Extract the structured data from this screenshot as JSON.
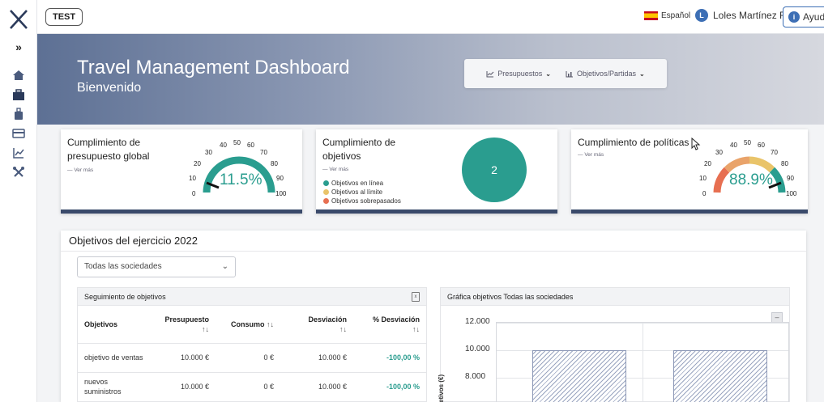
{
  "env": "TEST",
  "topbar": {
    "language": "Español",
    "user_initial": "L",
    "user_name": "Loles Martínez Roca",
    "help": "Ayuda"
  },
  "sidebar": {
    "expand": "»"
  },
  "hero": {
    "title": "Travel Management Dashboard",
    "subtitle": "Bienvenido",
    "menu": [
      {
        "label": "Presupuestos"
      },
      {
        "label": "Objetivos/Partidas"
      }
    ]
  },
  "cards": {
    "budget": {
      "title_1": "Cumplimiento de",
      "title_2": "presupuesto global",
      "more": "Ver más",
      "value": "11.5%",
      "ticks": [
        "0",
        "10",
        "20",
        "30",
        "40",
        "50",
        "60",
        "70",
        "80",
        "90",
        "100"
      ]
    },
    "goals": {
      "title_1": "Cumplimiento de",
      "title_2": "objetivos",
      "more": "Ver más",
      "count": "2",
      "legend": [
        {
          "label": "Objetivos en línea",
          "color": "#2a9d8f"
        },
        {
          "label": "Objetivos al límite",
          "color": "#e9c46a"
        },
        {
          "label": "Objetivos sobrepasados",
          "color": "#e76f51"
        }
      ]
    },
    "policies": {
      "title": "Cumplimiento de políticas",
      "more": "Ver más",
      "value": "88.9%",
      "ticks": [
        "0",
        "10",
        "20",
        "30",
        "40",
        "50",
        "60",
        "70",
        "80",
        "90",
        "100"
      ]
    }
  },
  "objectives": {
    "title": "Objetivos del ejercicio 2022",
    "company_select": "Todas las sociedades",
    "table": {
      "title": "Seguimiento de objetivos",
      "headers": {
        "objective": "Objetivos",
        "budget": "Presupuesto",
        "consumption": "Consumo",
        "deviation": "Desviación",
        "pct": "% Desviación",
        "sort": "↑↓"
      },
      "rows": [
        {
          "name": "objetivo de ventas",
          "budget": "10.000 €",
          "consumption": "0 €",
          "deviation": "10.000 €",
          "pct": "-100,00 %"
        },
        {
          "name": "nuevos suministros",
          "budget": "10.000 €",
          "consumption": "0 €",
          "deviation": "10.000 €",
          "pct": "-100,00 %"
        }
      ]
    },
    "chart": {
      "title": "Gráfica objetivos Todas las sociedades",
      "collapse": "–",
      "ylabel_fragment": "etivos (€)",
      "yticks": [
        "12.000",
        "10.000",
        "8.000"
      ]
    }
  },
  "colors": {
    "accent": "#2a9d8f",
    "warn": "#e9c46a",
    "danger": "#e76f51",
    "navy": "#3a4a6b"
  }
}
